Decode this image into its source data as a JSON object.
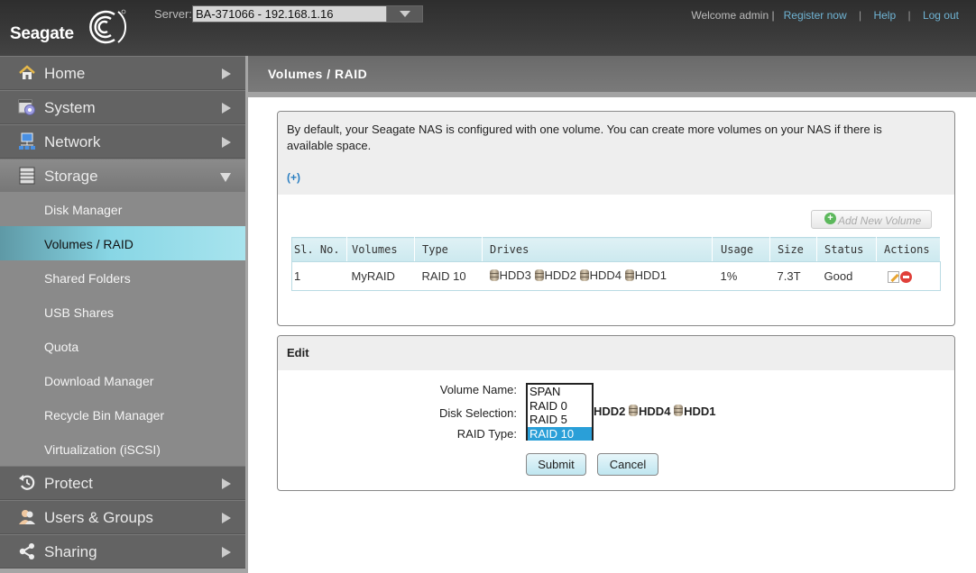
{
  "header": {
    "brand": "Seagate",
    "server_label": "Server:",
    "server_value": "BA-371066 - 192.168.1.16",
    "welcome": "Welcome admin |",
    "register": "Register now",
    "help": "Help",
    "logout": "Log out",
    "sep": "|"
  },
  "sidebar": {
    "main": [
      {
        "label": "Home",
        "icon": "home-icon"
      },
      {
        "label": "System",
        "icon": "system-settings-icon"
      },
      {
        "label": "Network",
        "icon": "network-icon"
      },
      {
        "label": "Storage",
        "icon": "storage-icon"
      },
      {
        "label": "Protect",
        "icon": "protect-icon"
      },
      {
        "label": "Users & Groups",
        "icon": "users-icon"
      },
      {
        "label": "Sharing",
        "icon": "share-icon"
      }
    ],
    "storage_sub": [
      {
        "label": "Disk Manager"
      },
      {
        "label": "Volumes / RAID"
      },
      {
        "label": "Shared Folders"
      },
      {
        "label": "USB Shares"
      },
      {
        "label": "Quota"
      },
      {
        "label": "Download Manager"
      },
      {
        "label": "Recycle Bin Manager"
      },
      {
        "label": "Virtualization (iSCSI)"
      }
    ],
    "active": "Volumes / RAID"
  },
  "page": {
    "title": "Volumes / RAID",
    "intro": "By default, your Seagate NAS is configured with one volume. You can create more volumes on your NAS if there is available space.",
    "expand": "(+)",
    "add_volume": "Add New Volume",
    "table": {
      "headers": [
        "Sl. No.",
        "Volumes",
        "Type",
        "Drives",
        "Usage",
        "Size",
        "Status",
        "Actions"
      ],
      "rows": [
        {
          "sl": "1",
          "volume": "MyRAID",
          "type": "RAID 10",
          "drives": [
            "HDD3",
            "HDD2",
            "HDD4",
            "HDD1"
          ],
          "usage": "1%",
          "size": "7.3T",
          "status": "Good"
        }
      ]
    }
  },
  "edit": {
    "title": "Edit",
    "volume_name_label": "Volume Name:",
    "disk_selection_label": "Disk Selection:",
    "raid_type_label": "RAID Type:",
    "raid_options": [
      "SPAN",
      "RAID 0",
      "RAID 5",
      "RAID 10"
    ],
    "raid_selected": "RAID 10",
    "disk_visible": [
      "HDD2",
      "HDD4",
      "HDD1"
    ],
    "submit": "Submit",
    "cancel": "Cancel"
  }
}
